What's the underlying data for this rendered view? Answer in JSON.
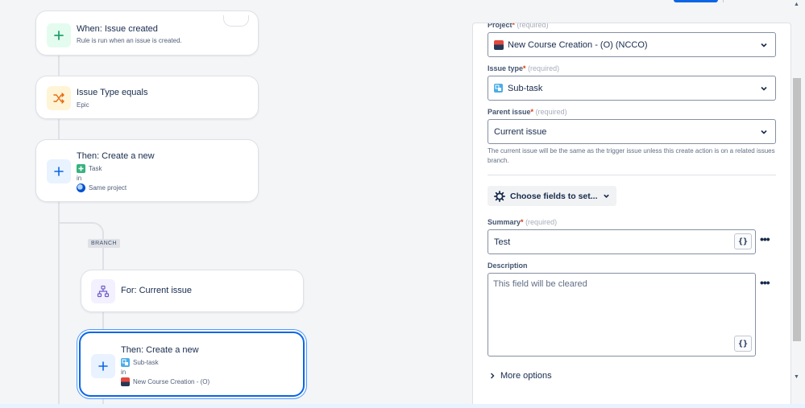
{
  "canvas": {
    "trigger": {
      "title": "When: Issue created",
      "subtitle": "Rule is run when an issue is created."
    },
    "condition": {
      "title": "Issue Type equals",
      "subtitle": "Epic"
    },
    "action1": {
      "title": "Then: Create a new",
      "type_label": "Task",
      "in_label": "in",
      "project_label": "Same project"
    },
    "branch_badge": "BRANCH",
    "branch": {
      "title": "For: Current issue"
    },
    "action2": {
      "title": "Then: Create a new",
      "type_label": "Sub-task",
      "in_label": "in",
      "project_label": "New Course Creation - (O)"
    }
  },
  "panel": {
    "project": {
      "label": "Project",
      "req_mark": "*",
      "req_text": "(required)",
      "value": "New Course Creation - (O) (NCCO)"
    },
    "issue_type": {
      "label": "Issue type",
      "req_mark": "*",
      "req_text": "(required)",
      "value": "Sub-task"
    },
    "parent_issue": {
      "label": "Parent issue",
      "req_mark": "*",
      "req_text": "(required)",
      "value": "Current issue"
    },
    "help_text": "The current issue will be the same as the trigger issue unless this create action is on a related issues branch.",
    "choose_fields_label": "Choose fields to set...",
    "summary": {
      "label": "Summary",
      "req_mark": "*",
      "req_text": "(required)",
      "value": "Test",
      "brace": "{}"
    },
    "description": {
      "label": "Description",
      "placeholder": "This field will be cleared",
      "brace": "{}"
    },
    "more_dots": "•••",
    "more_options_label": "More options"
  },
  "colors": {
    "accent": "#0c66e4",
    "required": "#de350b",
    "task_green": "#36b37e",
    "subtask_blue": "#4bade8"
  }
}
